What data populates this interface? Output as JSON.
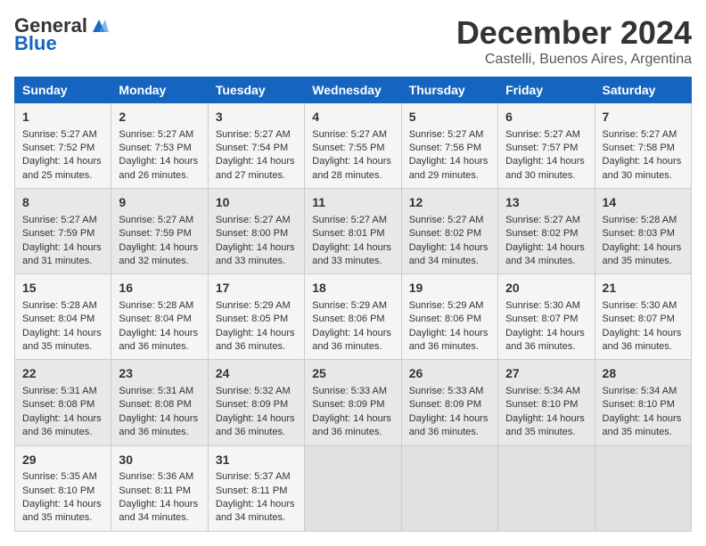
{
  "logo": {
    "general": "General",
    "blue": "Blue"
  },
  "header": {
    "month": "December 2024",
    "location": "Castelli, Buenos Aires, Argentina"
  },
  "weekdays": [
    "Sunday",
    "Monday",
    "Tuesday",
    "Wednesday",
    "Thursday",
    "Friday",
    "Saturday"
  ],
  "weeks": [
    [
      {
        "day": "1",
        "sunrise": "5:27 AM",
        "sunset": "7:52 PM",
        "daylight": "14 hours and 25 minutes."
      },
      {
        "day": "2",
        "sunrise": "5:27 AM",
        "sunset": "7:53 PM",
        "daylight": "14 hours and 26 minutes."
      },
      {
        "day": "3",
        "sunrise": "5:27 AM",
        "sunset": "7:54 PM",
        "daylight": "14 hours and 27 minutes."
      },
      {
        "day": "4",
        "sunrise": "5:27 AM",
        "sunset": "7:55 PM",
        "daylight": "14 hours and 28 minutes."
      },
      {
        "day": "5",
        "sunrise": "5:27 AM",
        "sunset": "7:56 PM",
        "daylight": "14 hours and 29 minutes."
      },
      {
        "day": "6",
        "sunrise": "5:27 AM",
        "sunset": "7:57 PM",
        "daylight": "14 hours and 30 minutes."
      },
      {
        "day": "7",
        "sunrise": "5:27 AM",
        "sunset": "7:58 PM",
        "daylight": "14 hours and 30 minutes."
      }
    ],
    [
      {
        "day": "8",
        "sunrise": "5:27 AM",
        "sunset": "7:59 PM",
        "daylight": "14 hours and 31 minutes."
      },
      {
        "day": "9",
        "sunrise": "5:27 AM",
        "sunset": "7:59 PM",
        "daylight": "14 hours and 32 minutes."
      },
      {
        "day": "10",
        "sunrise": "5:27 AM",
        "sunset": "8:00 PM",
        "daylight": "14 hours and 33 minutes."
      },
      {
        "day": "11",
        "sunrise": "5:27 AM",
        "sunset": "8:01 PM",
        "daylight": "14 hours and 33 minutes."
      },
      {
        "day": "12",
        "sunrise": "5:27 AM",
        "sunset": "8:02 PM",
        "daylight": "14 hours and 34 minutes."
      },
      {
        "day": "13",
        "sunrise": "5:27 AM",
        "sunset": "8:02 PM",
        "daylight": "14 hours and 34 minutes."
      },
      {
        "day": "14",
        "sunrise": "5:28 AM",
        "sunset": "8:03 PM",
        "daylight": "14 hours and 35 minutes."
      }
    ],
    [
      {
        "day": "15",
        "sunrise": "5:28 AM",
        "sunset": "8:04 PM",
        "daylight": "14 hours and 35 minutes."
      },
      {
        "day": "16",
        "sunrise": "5:28 AM",
        "sunset": "8:04 PM",
        "daylight": "14 hours and 36 minutes."
      },
      {
        "day": "17",
        "sunrise": "5:29 AM",
        "sunset": "8:05 PM",
        "daylight": "14 hours and 36 minutes."
      },
      {
        "day": "18",
        "sunrise": "5:29 AM",
        "sunset": "8:06 PM",
        "daylight": "14 hours and 36 minutes."
      },
      {
        "day": "19",
        "sunrise": "5:29 AM",
        "sunset": "8:06 PM",
        "daylight": "14 hours and 36 minutes."
      },
      {
        "day": "20",
        "sunrise": "5:30 AM",
        "sunset": "8:07 PM",
        "daylight": "14 hours and 36 minutes."
      },
      {
        "day": "21",
        "sunrise": "5:30 AM",
        "sunset": "8:07 PM",
        "daylight": "14 hours and 36 minutes."
      }
    ],
    [
      {
        "day": "22",
        "sunrise": "5:31 AM",
        "sunset": "8:08 PM",
        "daylight": "14 hours and 36 minutes."
      },
      {
        "day": "23",
        "sunrise": "5:31 AM",
        "sunset": "8:08 PM",
        "daylight": "14 hours and 36 minutes."
      },
      {
        "day": "24",
        "sunrise": "5:32 AM",
        "sunset": "8:09 PM",
        "daylight": "14 hours and 36 minutes."
      },
      {
        "day": "25",
        "sunrise": "5:33 AM",
        "sunset": "8:09 PM",
        "daylight": "14 hours and 36 minutes."
      },
      {
        "day": "26",
        "sunrise": "5:33 AM",
        "sunset": "8:09 PM",
        "daylight": "14 hours and 36 minutes."
      },
      {
        "day": "27",
        "sunrise": "5:34 AM",
        "sunset": "8:10 PM",
        "daylight": "14 hours and 35 minutes."
      },
      {
        "day": "28",
        "sunrise": "5:34 AM",
        "sunset": "8:10 PM",
        "daylight": "14 hours and 35 minutes."
      }
    ],
    [
      {
        "day": "29",
        "sunrise": "5:35 AM",
        "sunset": "8:10 PM",
        "daylight": "14 hours and 35 minutes."
      },
      {
        "day": "30",
        "sunrise": "5:36 AM",
        "sunset": "8:11 PM",
        "daylight": "14 hours and 34 minutes."
      },
      {
        "day": "31",
        "sunrise": "5:37 AM",
        "sunset": "8:11 PM",
        "daylight": "14 hours and 34 minutes."
      },
      null,
      null,
      null,
      null
    ]
  ],
  "labels": {
    "sunrise": "Sunrise:",
    "sunset": "Sunset:",
    "daylight": "Daylight:"
  }
}
